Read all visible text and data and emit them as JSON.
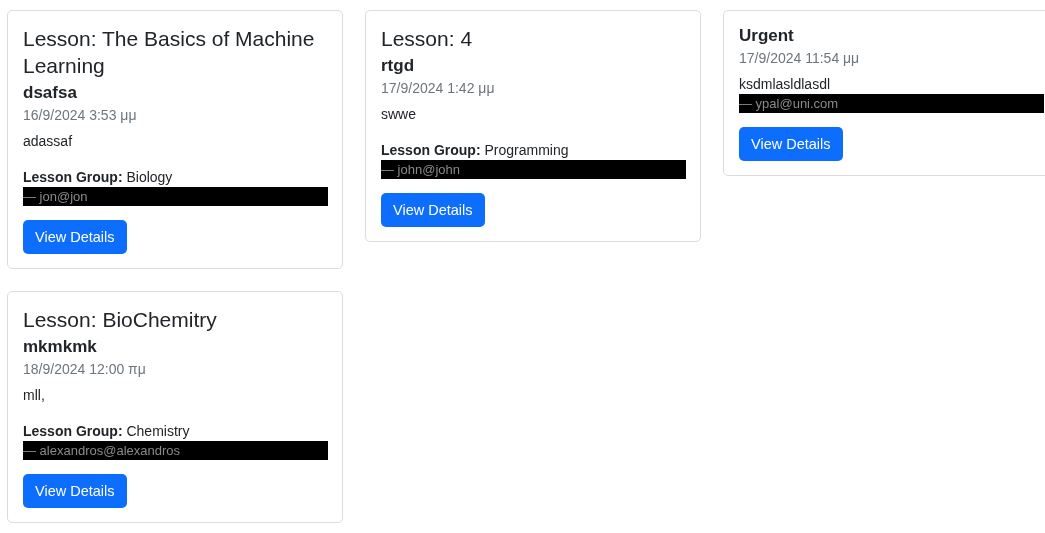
{
  "cards": [
    {
      "heading": "Lesson: The Basics of Machine Learning",
      "title": "dsafsa",
      "date": "16/9/2024 3:53 μμ",
      "text": "adassaf",
      "group": "**Lesson Group:** Biology",
      "author": "— jon@jon",
      "button": "View Details"
    },
    {
      "heading": "Lesson: 4",
      "title": "rtgd",
      "date": "17/9/2024 1:42 μμ",
      "text": "swwe",
      "group": "**Lesson Group:** Programming",
      "author": "— john@john",
      "button": "View Details"
    },
    {
      "title": "Urgent",
      "date": "17/9/2024 11:54 μμ",
      "text": "ksdmlasldlasdl",
      "author": "— ypal@uni.com",
      "button": "View Details"
    },
    {
      "heading": "Lesson: BioChemitry",
      "title": "mkmkmk",
      "date": "18/9/2024 12:00 πμ",
      "text": "mll,",
      "group": "**Lesson Group:** Chemistry",
      "author": "— alexandros@alexandros",
      "button": "View Details"
    }
  ]
}
